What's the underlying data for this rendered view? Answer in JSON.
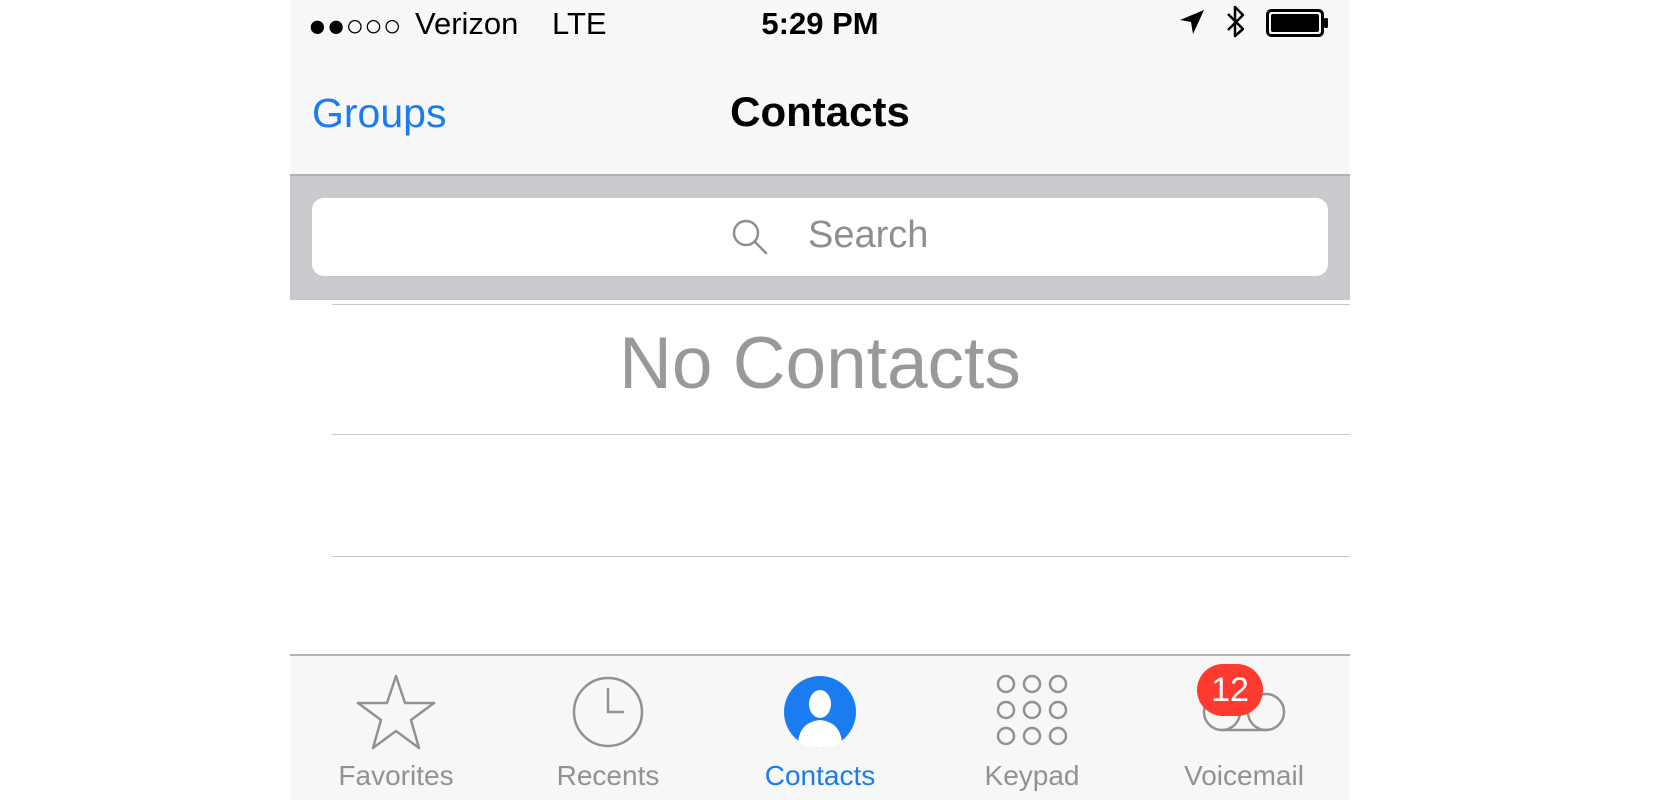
{
  "status_bar": {
    "signal": "●●○○○",
    "carrier": "Verizon",
    "network": "LTE",
    "time": "5:29 PM"
  },
  "nav": {
    "back_label": "Groups",
    "title": "Contacts"
  },
  "search": {
    "placeholder": "Search"
  },
  "content": {
    "empty_message": "No Contacts"
  },
  "tabs": [
    {
      "label": "Favorites",
      "icon": "star-icon"
    },
    {
      "label": "Recents",
      "icon": "clock-icon"
    },
    {
      "label": "Contacts",
      "icon": "person-icon",
      "active": true
    },
    {
      "label": "Keypad",
      "icon": "keypad-icon"
    },
    {
      "label": "Voicemail",
      "icon": "voicemail-icon",
      "badge": "12"
    }
  ],
  "colors": {
    "accent": "#1a7cf0",
    "badge": "#ff3b30",
    "inactive": "#929292"
  }
}
